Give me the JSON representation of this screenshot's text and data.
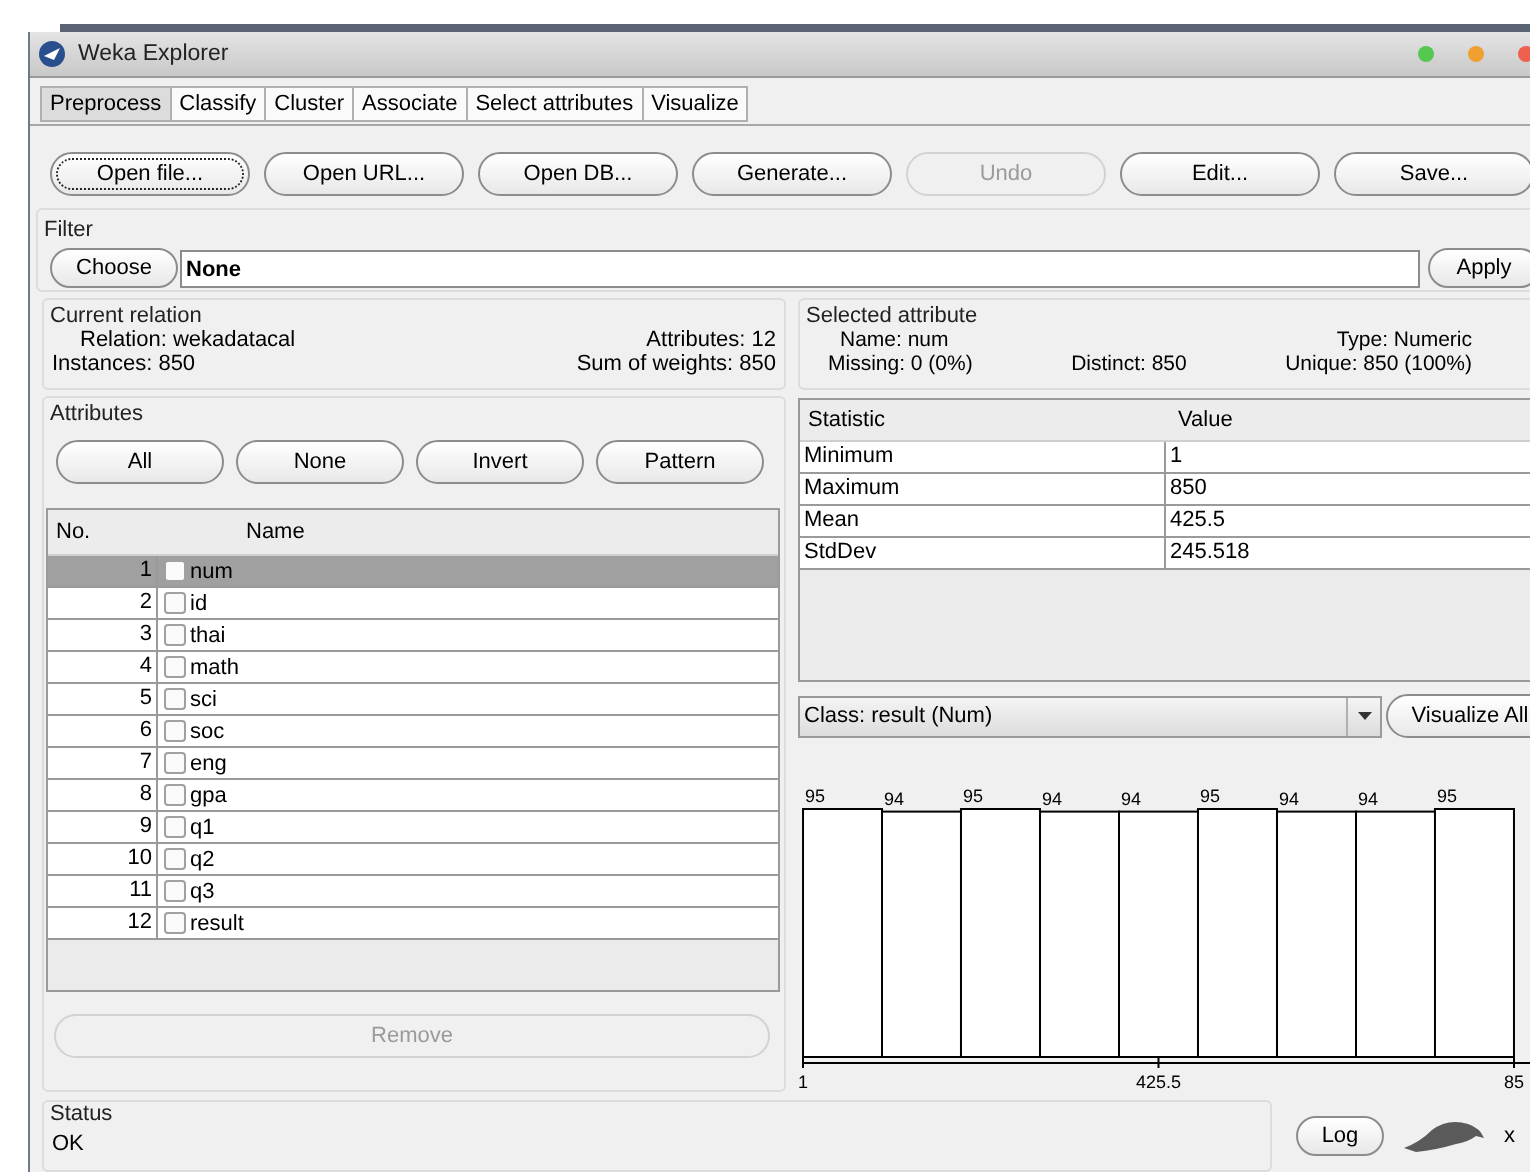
{
  "window": {
    "title": "Weka Explorer"
  },
  "tabs": [
    {
      "label": "Preprocess",
      "selected": true
    },
    {
      "label": "Classify",
      "selected": false
    },
    {
      "label": "Cluster",
      "selected": false
    },
    {
      "label": "Associate",
      "selected": false
    },
    {
      "label": "Select attributes",
      "selected": false
    },
    {
      "label": "Visualize",
      "selected": false
    }
  ],
  "toolbar": [
    {
      "label": "Open file...",
      "disabled": false,
      "focused": true
    },
    {
      "label": "Open URL...",
      "disabled": false,
      "focused": false
    },
    {
      "label": "Open DB...",
      "disabled": false,
      "focused": false
    },
    {
      "label": "Generate...",
      "disabled": false,
      "focused": false
    },
    {
      "label": "Undo",
      "disabled": true,
      "focused": false
    },
    {
      "label": "Edit...",
      "disabled": false,
      "focused": false
    },
    {
      "label": "Save...",
      "disabled": false,
      "focused": false
    }
  ],
  "filter": {
    "title": "Filter",
    "choose": "Choose",
    "value": "None",
    "apply": "Apply"
  },
  "current_relation": {
    "title": "Current relation",
    "fields": [
      [
        {
          "label": "Relation:",
          "value": "wekadatacal"
        },
        {
          "label": "Attributes:",
          "value": "12"
        }
      ],
      [
        {
          "label": "Instances:",
          "value": "850"
        },
        {
          "label": "Sum of weights:",
          "value": "850"
        }
      ]
    ]
  },
  "attributes": {
    "title": "Attributes",
    "buttons": [
      "All",
      "None",
      "Invert",
      "Pattern"
    ],
    "columns": [
      "No.",
      "Name"
    ],
    "rows": [
      {
        "no": "1",
        "name": "num",
        "checked": false,
        "selected": true
      },
      {
        "no": "2",
        "name": "id",
        "checked": false,
        "selected": false
      },
      {
        "no": "3",
        "name": "thai",
        "checked": false,
        "selected": false
      },
      {
        "no": "4",
        "name": "math",
        "checked": false,
        "selected": false
      },
      {
        "no": "5",
        "name": "sci",
        "checked": false,
        "selected": false
      },
      {
        "no": "6",
        "name": "soc",
        "checked": false,
        "selected": false
      },
      {
        "no": "7",
        "name": "eng",
        "checked": false,
        "selected": false
      },
      {
        "no": "8",
        "name": "gpa",
        "checked": false,
        "selected": false
      },
      {
        "no": "9",
        "name": "q1",
        "checked": false,
        "selected": false
      },
      {
        "no": "10",
        "name": "q2",
        "checked": false,
        "selected": false
      },
      {
        "no": "11",
        "name": "q3",
        "checked": false,
        "selected": false
      },
      {
        "no": "12",
        "name": "result",
        "checked": false,
        "selected": false
      }
    ],
    "remove": {
      "label": "Remove",
      "disabled": true
    }
  },
  "selected_attribute": {
    "title": "Selected attribute",
    "fields": [
      [
        {
          "label": "Name:",
          "value": "num"
        },
        {
          "label": "Type:",
          "value": "Numeric"
        }
      ],
      [
        {
          "label": "Missing:",
          "value": "0 (0%)"
        },
        {
          "label": "Distinct:",
          "value": "850"
        },
        {
          "label": "Unique:",
          "value": "850 (100%)"
        }
      ]
    ],
    "statistics": {
      "columns": [
        "Statistic",
        "Value"
      ],
      "rows": [
        [
          "Minimum",
          "1"
        ],
        [
          "Maximum",
          "850"
        ],
        [
          "Mean",
          "425.5"
        ],
        [
          "StdDev",
          "245.518"
        ]
      ]
    }
  },
  "class_select": {
    "value": "Class: result (Num)"
  },
  "visualize_all": "Visualize All",
  "histogram": {
    "chart_data": {
      "type": "bar",
      "x": [
        48.2,
        142.5,
        236.8,
        331.2,
        425.5,
        519.8,
        614.2,
        708.5,
        802.8
      ],
      "values": [
        95,
        94,
        95,
        94,
        94,
        95,
        94,
        94,
        95
      ],
      "data_labels": true,
      "xlim": [
        1,
        850
      ],
      "xticks": [
        1,
        425.5
      ]
    },
    "axis_end_label": "85"
  },
  "status": {
    "title": "Status",
    "text": "OK",
    "log": "Log",
    "count": "x"
  }
}
